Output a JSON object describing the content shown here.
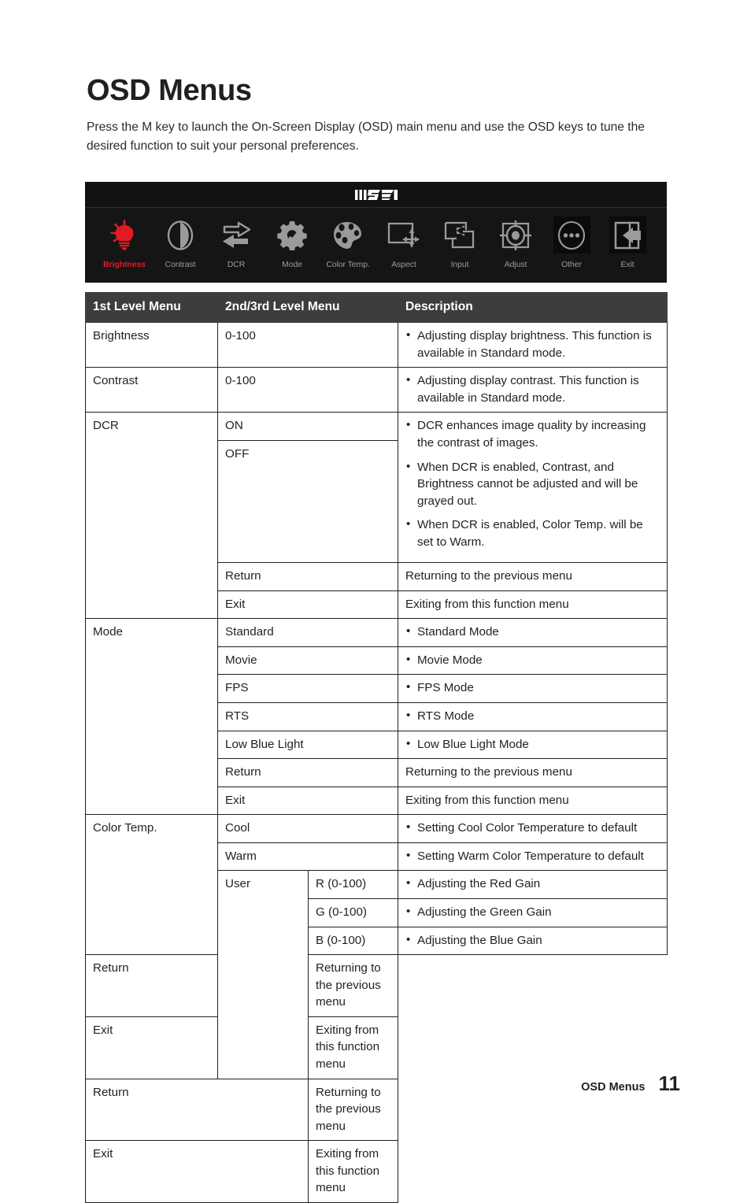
{
  "page": {
    "title": "OSD Menus",
    "intro": "Press the M key to launch the On-Screen Display (OSD) main menu and use the OSD keys to tune the desired function to suit your personal preferences.",
    "footer_label": "OSD Menus",
    "footer_page": "11"
  },
  "osd_bar": {
    "brand": "MSI",
    "background": "#151515",
    "active_color": "#e01b24",
    "inactive_color": "#9a9a9a",
    "items": [
      {
        "label": "Brightness",
        "icon": "brightness-bulb-icon",
        "active": true,
        "boxed": false
      },
      {
        "label": "Contrast",
        "icon": "contrast-circle-icon",
        "active": false,
        "boxed": false
      },
      {
        "label": "DCR",
        "icon": "dcr-arrows-icon",
        "active": false,
        "boxed": false
      },
      {
        "label": "Mode",
        "icon": "mode-gear-check-icon",
        "active": false,
        "boxed": false
      },
      {
        "label": "Color Temp.",
        "icon": "color-palette-icon",
        "active": false,
        "boxed": false
      },
      {
        "label": "Aspect",
        "icon": "aspect-frame-icon",
        "active": false,
        "boxed": false
      },
      {
        "label": "Input",
        "icon": "input-source-icon",
        "active": false,
        "boxed": false
      },
      {
        "label": "Adjust",
        "icon": "adjust-target-icon",
        "active": false,
        "boxed": false
      },
      {
        "label": "Other",
        "icon": "other-ellipsis-icon",
        "active": false,
        "boxed": true
      },
      {
        "label": "Exit",
        "icon": "exit-arrow-icon",
        "active": false,
        "boxed": true
      }
    ]
  },
  "table": {
    "headers": {
      "col1": "1st Level Menu",
      "col2": "2nd/3rd Level Menu",
      "col3": "Description"
    },
    "rows": {
      "brightness": {
        "name": "Brightness",
        "level2": "0-100",
        "desc": "Adjusting display brightness. This function is available in Standard mode."
      },
      "contrast": {
        "name": "Contrast",
        "level2": "0-100",
        "desc": "Adjusting display contrast. This function is available in Standard mode."
      },
      "dcr": {
        "name": "DCR",
        "on": "ON",
        "off": "OFF",
        "desc1": "DCR enhances image quality by increasing the contrast of images.",
        "desc2": "When DCR is enabled, Contrast, and Brightness cannot be adjusted and will be grayed out.",
        "desc3": "When DCR is enabled, Color Temp. will be set to Warm.",
        "return": "Return",
        "return_desc": "Returning to the previous menu",
        "exit": "Exit",
        "exit_desc": "Exiting from this function menu"
      },
      "mode": {
        "name": "Mode",
        "standard": "Standard",
        "standard_desc": "Standard Mode",
        "movie": "Movie",
        "movie_desc": "Movie Mode",
        "fps": "FPS",
        "fps_desc": "FPS Mode",
        "rts": "RTS",
        "rts_desc": "RTS Mode",
        "lowblue": "Low Blue Light",
        "lowblue_desc": "Low Blue Light Mode",
        "return": "Return",
        "return_desc": "Returning to the previous menu",
        "exit": "Exit",
        "exit_desc": "Exiting from this function menu"
      },
      "colortemp": {
        "name": "Color Temp.",
        "cool": "Cool",
        "cool_desc": "Setting Cool Color Temperature to default",
        "warm": "Warm",
        "warm_desc": "Setting Warm Color Temperature to default",
        "user": "User",
        "r": "R (0-100)",
        "r_desc": "Adjusting the Red Gain",
        "g": "G (0-100)",
        "g_desc": "Adjusting the Green Gain",
        "b": "B (0-100)",
        "b_desc": "Adjusting the Blue Gain",
        "user_return": "Return",
        "user_return_desc": "Returning to the previous menu",
        "user_exit": "Exit",
        "user_exit_desc": "Exiting from this function menu",
        "return": "Return",
        "return_desc": "Returning to the previous menu",
        "exit": "Exit",
        "exit_desc": "Exiting from this function menu"
      }
    }
  }
}
